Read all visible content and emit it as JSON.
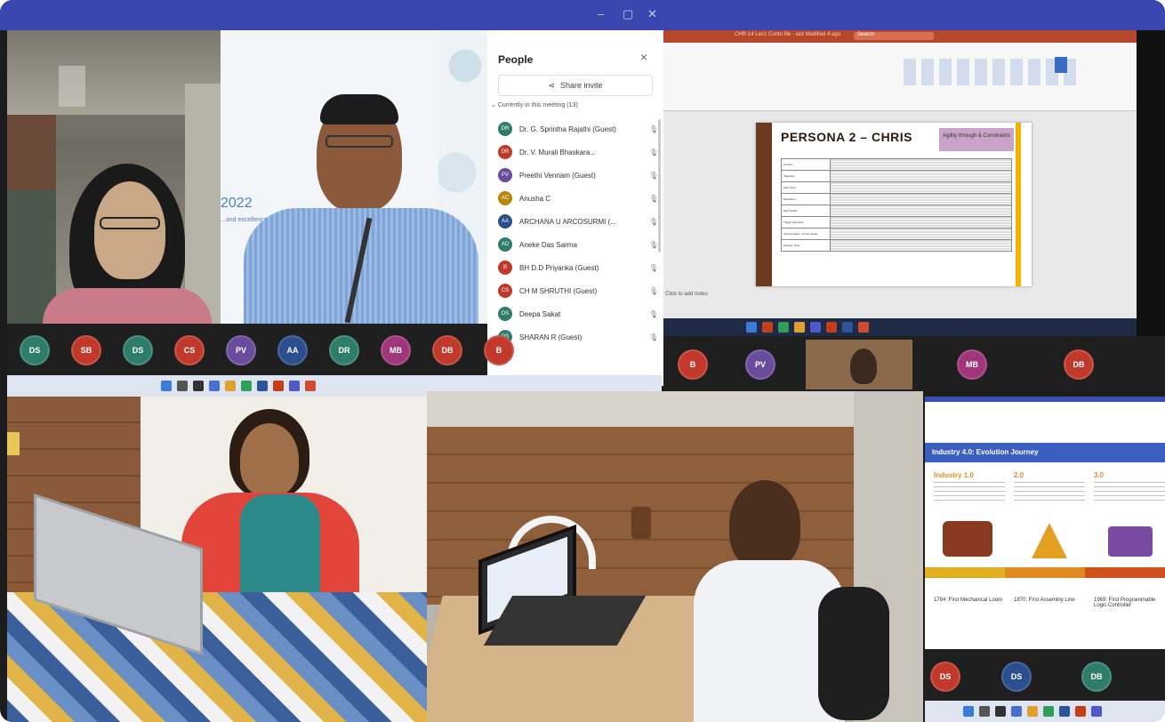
{
  "window": {
    "controls": [
      "–",
      "▢",
      "✕"
    ]
  },
  "people_panel": {
    "title": "People",
    "close": "×",
    "share_invite": "Share invite",
    "section": "Currently in this meeting (13)",
    "participants": [
      {
        "initials": "DR",
        "name": "Dr. G. Sprintha Rajathi (Guest)",
        "color": "#2e7d6b"
      },
      {
        "initials": "DR",
        "name": "Dr. V. Murali Bhaskara...",
        "color": "#c0392b"
      },
      {
        "initials": "PV",
        "name": "Preethi Vennam (Guest)",
        "color": "#6a4c9c"
      },
      {
        "initials": "AC",
        "name": "Anusha C",
        "color": "#b8860b"
      },
      {
        "initials": "AA",
        "name": "ARCHANA U ARCOSURMI (...",
        "color": "#2b4e8c"
      },
      {
        "initials": "AD",
        "name": "Aneke Das Sarma",
        "color": "#2e7d6b"
      },
      {
        "initials": "B",
        "name": "BH D.D Priyanka (Guest)",
        "color": "#c0392b"
      },
      {
        "initials": "CS",
        "name": "CH M SHRUTHI (Guest)",
        "color": "#c0392b"
      },
      {
        "initials": "DS",
        "name": "Deepa Sakat",
        "color": "#2e7d6b"
      },
      {
        "initials": "DS",
        "name": "SHARAN R (Guest)",
        "color": "#2e7d6b"
      }
    ]
  },
  "background_banner": {
    "year": "2022",
    "tagline": "...and excellence in opera"
  },
  "avatar_strip": [
    "DS",
    "SB",
    "DS",
    "CS",
    "PV",
    "AA",
    "DR",
    "MB",
    "DB",
    "B"
  ],
  "avatar_colors": [
    "#2e7d6b",
    "#c0392b",
    "#2e7d6b",
    "#c0392b",
    "#6a4c9c",
    "#2b4e8c",
    "#2e7d6b",
    "#a0367a",
    "#c0392b",
    "#c0392b"
  ],
  "ppt": {
    "title_bar": "CHR-14 Lec1 Contn file - last Modified 4 ago",
    "search": "Search",
    "slide_title": "PERSONA 2 – CHRIS",
    "slide_badge": "Agility through & Constraints",
    "notes": "Click to add notes",
    "table_rows": [
      "Context",
      "Objective",
      "Pain Point",
      "Motivation",
      "Brief Profile",
      "Trigger Moments",
      "Opportunities / Unmet Needs",
      "Solution Type"
    ]
  },
  "middle_strip": [
    "B",
    "PV",
    "MB",
    "DB"
  ],
  "middle_strip_colors": [
    "#c0392b",
    "#6a4c9c",
    "#a0367a",
    "#c0392b"
  ],
  "industry": {
    "header": "Industry 4.0: Evolution Journey",
    "columns": [
      {
        "title": "Industry 1.0",
        "caption": "1784: First Mechanical Loom"
      },
      {
        "title": "2.0",
        "caption": "1870: First Assembly Line"
      },
      {
        "title": "3.0",
        "caption": "1969: First Programmable Logic Controller"
      }
    ],
    "strip": [
      "DS",
      "DS",
      "DB"
    ]
  }
}
